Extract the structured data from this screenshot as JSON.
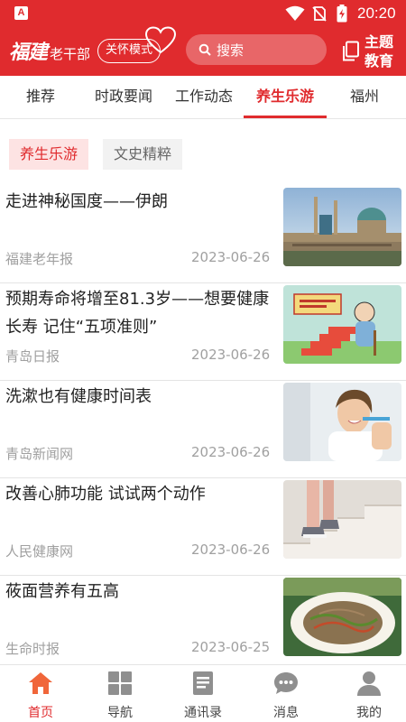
{
  "status_bar": {
    "app_badge": "A",
    "time": "20:20"
  },
  "header": {
    "logo_script": "福建",
    "logo_sub": "老干部",
    "care_mode_label": "关怀模式",
    "search_placeholder": "搜索",
    "theme_label": "主题教育"
  },
  "tabs": [
    {
      "label": "推荐",
      "active": false
    },
    {
      "label": "时政要闻",
      "active": false
    },
    {
      "label": "工作动态",
      "active": false
    },
    {
      "label": "养生乐游",
      "active": true
    },
    {
      "label": "福州",
      "active": false
    }
  ],
  "sub_tabs": [
    {
      "label": "养生乐游",
      "active": true
    },
    {
      "label": "文史精粹",
      "active": false
    }
  ],
  "news": [
    {
      "title": "走进神秘国度——伊朗",
      "source": "福建老年报",
      "date": "2023-06-26",
      "image": "mosque-photo"
    },
    {
      "title": "预期寿命将增至81.3岁——想要健康长寿 记住“五项准则”",
      "source": "青岛日报",
      "date": "2023-06-26",
      "image": "longevity-cartoon"
    },
    {
      "title": "洗漱也有健康时间表",
      "source": "青岛新闻网",
      "date": "2023-06-26",
      "image": "woman-brushing-teeth-photo"
    },
    {
      "title": "改善心肺功能 试试两个动作",
      "source": "人民健康网",
      "date": "2023-06-26",
      "image": "stair-climbing-photo"
    },
    {
      "title": "莜面营养有五高",
      "source": "生命时报",
      "date": "2023-06-25",
      "image": "oat-noodles-photo"
    }
  ],
  "bottom_nav": [
    {
      "label": "首页",
      "icon": "home-icon",
      "active": true
    },
    {
      "label": "导航",
      "icon": "grid-icon",
      "active": false
    },
    {
      "label": "通讯录",
      "icon": "contacts-book-icon",
      "active": false
    },
    {
      "label": "消息",
      "icon": "message-bubble-icon",
      "active": false
    },
    {
      "label": "我的",
      "icon": "person-icon",
      "active": false
    }
  ],
  "colors": {
    "brand_red": "#e02b2e",
    "active_subtab_bg": "#fde3e3",
    "muted_text": "#a0a0a0"
  }
}
